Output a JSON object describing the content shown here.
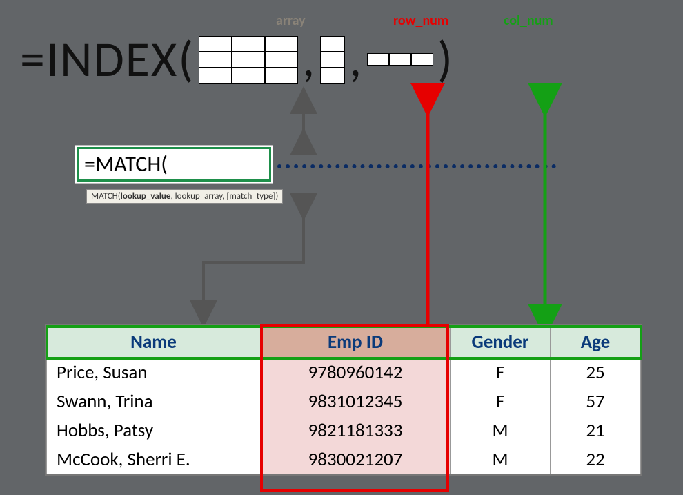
{
  "labels": {
    "array": "array",
    "row_num": "row_num",
    "col_num": "col_num"
  },
  "formula": {
    "prefix": "=INDEX(",
    "comma": ",",
    "close": ")"
  },
  "match": {
    "text": "=MATCH(",
    "tooltip_pre": "MATCH(",
    "tooltip_bold": "lookup_value",
    "tooltip_post": ", lookup_array, [match_type])"
  },
  "table": {
    "headers": {
      "name": "Name",
      "emp": "Emp ID",
      "gender": "Gender",
      "age": "Age"
    },
    "rows": [
      {
        "name": "Price, Susan",
        "emp": "9780960142",
        "gender": "F",
        "age": "25"
      },
      {
        "name": "Swann, Trina",
        "emp": "9831012345",
        "gender": "F",
        "age": "57"
      },
      {
        "name": "Hobbs, Patsy",
        "emp": "9821181333",
        "gender": "M",
        "age": "21"
      },
      {
        "name": "McCook, Sherri E.",
        "emp": "9830021207",
        "gender": "M",
        "age": "22"
      }
    ]
  }
}
